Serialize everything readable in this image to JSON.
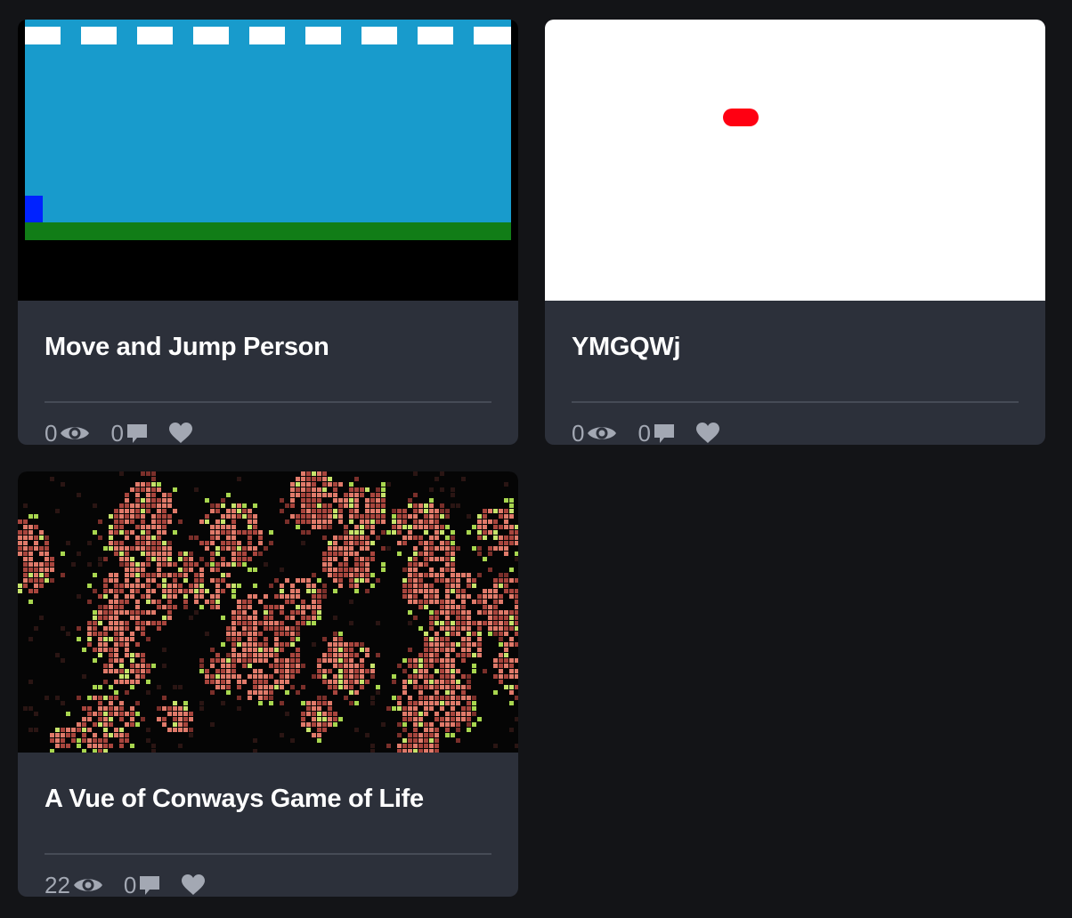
{
  "cards": [
    {
      "title": "Move and Jump Person",
      "views": "0",
      "comments": "0",
      "preview": "platformer-scene"
    },
    {
      "title": "YMGQWj",
      "views": "0",
      "comments": "0",
      "preview": "red-ball-on-white"
    },
    {
      "title": "A Vue of Conways Game of Life",
      "views": "22",
      "comments": "0",
      "preview": "game-of-life-grid"
    }
  ],
  "icons": {
    "views": "eye-icon",
    "comments": "comment-icon",
    "like": "heart-icon"
  },
  "colors": {
    "page_background": "#131417",
    "card_background": "#2c303a",
    "title_text": "#ffffff",
    "meta_text": "#a3a8b3",
    "sky": "#189bcc",
    "ground": "#117d17",
    "player": "#0022ff",
    "ball": "#ff0012"
  }
}
